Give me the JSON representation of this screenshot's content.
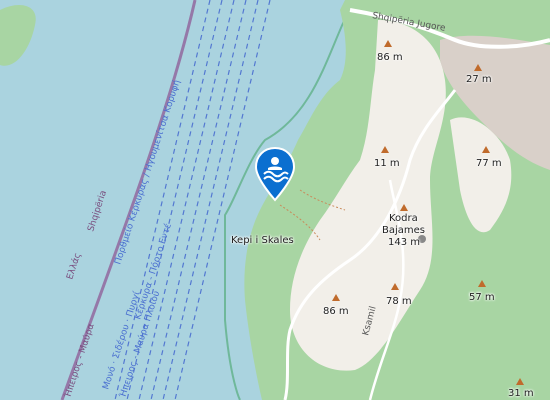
{
  "colors": {
    "water": "#aad3df",
    "land_green": "#a8d5a3",
    "land_light": "#f2efe9",
    "town": "#d9d0c9",
    "border": "#8e5a96",
    "ferry_lane": "#4a6fd0",
    "marker": "#0b6fd0",
    "peak": "#c06b2c"
  },
  "marker": {
    "icon": "swimming-icon",
    "label": "Kepi i Skales"
  },
  "place_labels": [
    {
      "id": "kodra-name-1",
      "text": "Kodra"
    },
    {
      "id": "kodra-name-2",
      "text": "Bajames"
    },
    {
      "id": "kodra-elev",
      "text": "143 m"
    }
  ],
  "elevations": [
    {
      "id": "e86top",
      "text": "86 m"
    },
    {
      "id": "e27",
      "text": "27 m"
    },
    {
      "id": "e11",
      "text": "11 m"
    },
    {
      "id": "e77",
      "text": "77 m"
    },
    {
      "id": "e86",
      "text": "86 m"
    },
    {
      "id": "e78",
      "text": "78 m"
    },
    {
      "id": "e57",
      "text": "57 m"
    },
    {
      "id": "e31",
      "text": "31 m"
    }
  ],
  "road_labels": {
    "shqiperia_jugore": "Shqipëria Jugore",
    "ksamil": "Ksamil"
  },
  "border_labels": {
    "shqiperia": "Shqipëria",
    "ellas": "Ελλάς",
    "greek_region": "Ήπειρος - Μαύρα"
  },
  "ferry_labels": {
    "corfu_greek": "Πορθμείο Κέρκυρας / Ηγουμενίτσα Κορυφή",
    "corfu_lane": "Μονό · Σιδέρου · Πυργί",
    "vessel_lane": "Κέρκυρα - Πόρτο Εντέ",
    "lower_lane": "Ήπειρος - Μαύρα Πλοίου"
  }
}
